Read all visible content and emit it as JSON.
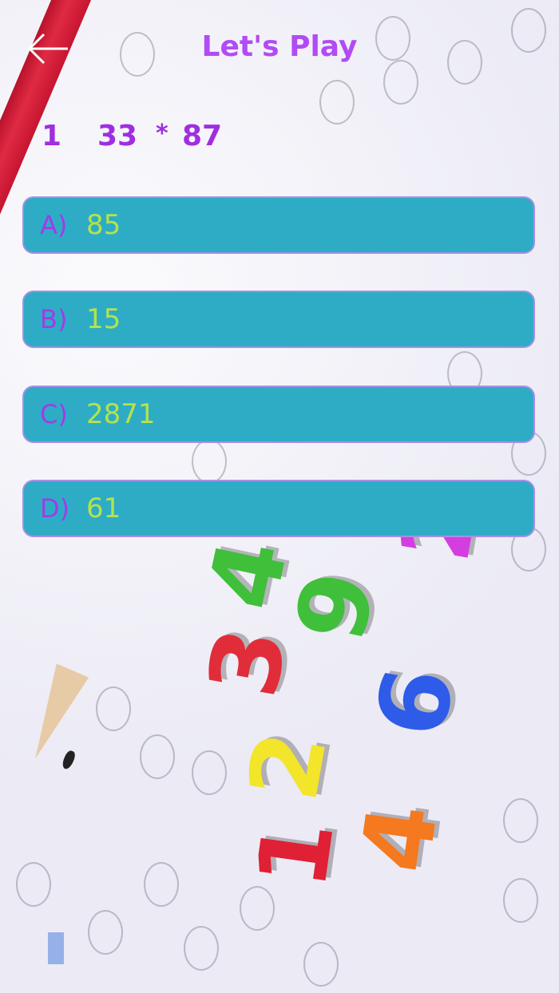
{
  "header": {
    "title": "Let's Play",
    "back_icon": "arrow-left-icon"
  },
  "question": {
    "number": "1",
    "operand_a": "33",
    "operator": "*",
    "operand_b": "87"
  },
  "options": [
    {
      "letter": "A)",
      "value": "85"
    },
    {
      "letter": "B)",
      "value": "15"
    },
    {
      "letter": "C)",
      "value": "2871"
    },
    {
      "letter": "D)",
      "value": "61"
    }
  ],
  "colors": {
    "title": "#b24bf3",
    "question": "#a02ee0",
    "option_background": "#2eacc5",
    "option_border": "#a88fe6",
    "option_letter": "#a23be8",
    "option_value": "#b4e34a"
  }
}
